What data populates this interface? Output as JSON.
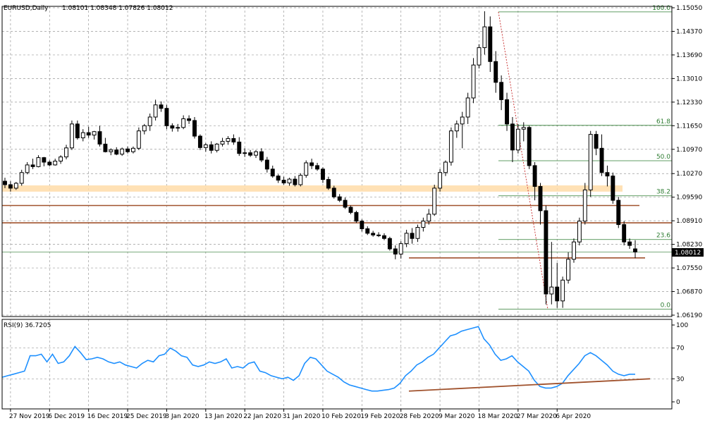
{
  "header": {
    "symbol": "EURUSD,Daily",
    "ohlc": "1.08101 1.08348 1.07826 1.08012"
  },
  "rsi": {
    "label": "RSI(9) 36.7205",
    "ticks": [
      "100",
      "70",
      "30",
      "0"
    ],
    "color": "#1e90ff"
  },
  "price_tag": {
    "value": "1.08012",
    "bg": "#000000"
  },
  "fib_color": "#2e7d32",
  "trendline_color": "#a0522d",
  "chart_data": {
    "type": "candlestick",
    "title": "EURUSD,Daily",
    "y_ticks": [
      "1.15050",
      "1.14370",
      "1.13690",
      "1.13010",
      "1.12330",
      "1.11650",
      "1.10970",
      "1.10270",
      "1.09590",
      "1.08910",
      "1.08230",
      "1.07550",
      "1.06870",
      "1.06190"
    ],
    "ylim": [
      1.0619,
      1.1505
    ],
    "x_ticks": [
      "27 Nov 2019",
      "6 Dec 2019",
      "16 Dec 2019",
      "25 Dec 2019",
      "3 Jan 2020",
      "13 Jan 2020",
      "22 Jan 2020",
      "31 Jan 2020",
      "10 Feb 2020",
      "19 Feb 2020",
      "28 Feb 2020",
      "9 Mar 2020",
      "18 Mar 2020",
      "27 Mar 2020",
      "6 Apr 2020"
    ],
    "candles": [
      [
        "1.1005",
        "1.1015",
        "1.0985",
        "1.0995"
      ],
      [
        "1.0995",
        "1.1005",
        "1.0975",
        "1.0985"
      ],
      [
        "1.0985",
        "1.1003",
        "1.0980",
        "1.0999"
      ],
      [
        "1.0999",
        "1.1038",
        "1.0992",
        "1.1030"
      ],
      [
        "1.1030",
        "1.1060",
        "1.1025",
        "1.1052"
      ],
      [
        "1.1052",
        "1.1070",
        "1.1040",
        "1.1047"
      ],
      [
        "1.1047",
        "1.1080",
        "1.1045",
        "1.1073"
      ],
      [
        "1.1073",
        "1.1075",
        "1.1048",
        "1.1060"
      ],
      [
        "1.1060",
        "1.1065",
        "1.1048",
        "1.1052"
      ],
      [
        "1.1052",
        "1.1070",
        "1.1050",
        "1.1063"
      ],
      [
        "1.1063",
        "1.1080",
        "1.1055",
        "1.1075"
      ],
      [
        "1.1075",
        "1.1110",
        "1.1068",
        "1.1101"
      ],
      [
        "1.1101",
        "1.1180",
        "1.1095",
        "1.1170"
      ],
      [
        "1.1170",
        "1.1180",
        "1.1125",
        "1.1130"
      ],
      [
        "1.1130",
        "1.1155",
        "1.1120",
        "1.1145"
      ],
      [
        "1.1145",
        "1.1162",
        "1.1130",
        "1.1138"
      ],
      [
        "1.1138",
        "1.1150",
        "1.1125",
        "1.1148"
      ],
      [
        "1.1148",
        "1.1165",
        "1.1105",
        "1.1112"
      ],
      [
        "1.1112",
        "1.1130",
        "1.1088",
        "1.1090"
      ],
      [
        "1.1090",
        "1.1100",
        "1.1080",
        "1.1095"
      ],
      [
        "1.1095",
        "1.1103",
        "1.1080",
        "1.1083"
      ],
      [
        "1.1083",
        "1.1102",
        "1.1078",
        "1.1098"
      ],
      [
        "1.1098",
        "1.1105",
        "1.1085",
        "1.1090"
      ],
      [
        "1.1090",
        "1.1105",
        "1.1085",
        "1.1100"
      ],
      [
        "1.1100",
        "1.1160",
        "1.1095",
        "1.1150"
      ],
      [
        "1.1150",
        "1.1170",
        "1.1140",
        "1.1165"
      ],
      [
        "1.1165",
        "1.1200",
        "1.1150",
        "1.1190"
      ],
      [
        "1.1190",
        "1.1240",
        "1.1180",
        "1.1225"
      ],
      [
        "1.1225",
        "1.1235",
        "1.1205",
        "1.1215"
      ],
      [
        "1.1215",
        "1.1225",
        "1.1155",
        "1.1165"
      ],
      [
        "1.1165",
        "1.1172",
        "1.1148",
        "1.1158"
      ],
      [
        "1.1158",
        "1.1170",
        "1.1148",
        "1.1160"
      ],
      [
        "1.1160",
        "1.1195",
        "1.1155",
        "1.1185"
      ],
      [
        "1.1185",
        "1.1195",
        "1.1170",
        "1.1180"
      ],
      [
        "1.1180",
        "1.1190",
        "1.1128",
        "1.1135"
      ],
      [
        "1.1135",
        "1.1140",
        "1.1095",
        "1.1102"
      ],
      [
        "1.1102",
        "1.1115",
        "1.1090",
        "1.1110"
      ],
      [
        "1.1110",
        "1.1120",
        "1.1085",
        "1.1094"
      ],
      [
        "1.1094",
        "1.1115",
        "1.1088",
        "1.1112"
      ],
      [
        "1.1112",
        "1.1130",
        "1.1105",
        "1.1120"
      ],
      [
        "1.1120",
        "1.1135",
        "1.1110",
        "1.1128"
      ],
      [
        "1.1128",
        "1.1140",
        "1.1110",
        "1.1118"
      ],
      [
        "1.1118",
        "1.1132",
        "1.1078",
        "1.1085"
      ],
      [
        "1.1085",
        "1.1100",
        "1.1075",
        "1.1087"
      ],
      [
        "1.1087",
        "1.1095",
        "1.1075",
        "1.1080"
      ],
      [
        "1.1080",
        "1.1095",
        "1.1072",
        "1.1090"
      ],
      [
        "1.1090",
        "1.1100",
        "1.1060",
        "1.1066"
      ],
      [
        "1.1066",
        "1.1075",
        "1.1030",
        "1.1040"
      ],
      [
        "1.1040",
        "1.1050",
        "1.1015",
        "1.1020"
      ],
      [
        "1.1020",
        "1.1025",
        "1.1000",
        "1.1008"
      ],
      [
        "1.1008",
        "1.1018",
        "1.0995",
        "1.1000"
      ],
      [
        "1.1000",
        "1.1015",
        "1.0992",
        "1.1011"
      ],
      [
        "1.1011",
        "1.1020",
        "1.0990",
        "1.0995"
      ],
      [
        "1.0995",
        "1.1028",
        "1.0990",
        "1.1022"
      ],
      [
        "1.1022",
        "1.1065",
        "1.1015",
        "1.1058"
      ],
      [
        "1.1058",
        "1.1070",
        "1.1040",
        "1.1050"
      ],
      [
        "1.1050",
        "1.1058",
        "1.1035",
        "1.1040"
      ],
      [
        "1.1040",
        "1.1045",
        "1.1000",
        "1.1010"
      ],
      [
        "1.1010",
        "1.1018",
        "1.0980",
        "1.0985"
      ],
      [
        "1.0985",
        "1.0992",
        "1.0955",
        "1.0960"
      ],
      [
        "1.0960",
        "1.0968",
        "1.0945",
        "1.0950"
      ],
      [
        "1.0950",
        "1.0958",
        "1.0925",
        "1.0930"
      ],
      [
        "1.0930",
        "1.0935",
        "1.0910",
        "1.0915"
      ],
      [
        "1.0915",
        "1.0920",
        "1.0885",
        "1.0890"
      ],
      [
        "1.0890",
        "1.0895",
        "1.0860",
        "1.0868"
      ],
      [
        "1.0868",
        "1.0875",
        "1.0850",
        "1.0855"
      ],
      [
        "1.0855",
        "1.0862",
        "1.0845",
        "1.0850"
      ],
      [
        "1.0850",
        "1.0858",
        "1.0844",
        "1.0848"
      ],
      [
        "1.0848",
        "1.0855",
        "1.0835",
        "1.0840"
      ],
      [
        "1.0840",
        "1.0845",
        "1.0805",
        "1.0810"
      ],
      [
        "1.0810",
        "1.0820",
        "1.0780",
        "1.0795"
      ],
      [
        "1.0795",
        "1.0832",
        "1.0782",
        "1.0825"
      ],
      [
        "1.0825",
        "1.0865",
        "1.0815",
        "1.0855"
      ],
      [
        "1.0855",
        "1.0870",
        "1.0825",
        "1.0840"
      ],
      [
        "1.0840",
        "1.0880",
        "1.0830",
        "1.0872"
      ],
      [
        "1.0872",
        "1.0900",
        "1.0860",
        "1.0890"
      ],
      [
        "1.0890",
        "1.0925",
        "1.0880",
        "1.0910"
      ],
      [
        "1.0910",
        "1.0995",
        "1.0905",
        "1.0985"
      ],
      [
        "1.0985",
        "1.1040",
        "1.0975",
        "1.1030"
      ],
      [
        "1.1030",
        "1.1065",
        "1.1020",
        "1.1060"
      ],
      [
        "1.1060",
        "1.1160",
        "1.1050",
        "1.1150"
      ],
      [
        "1.1150",
        "1.1180",
        "1.1130",
        "1.1170"
      ],
      [
        "1.1170",
        "1.1205",
        "1.1100",
        "1.1190"
      ],
      [
        "1.1190",
        "1.1260",
        "1.1170",
        "1.1245"
      ],
      [
        "1.1245",
        "1.1360",
        "1.1230",
        "1.1340"
      ],
      [
        "1.1340",
        "1.1400",
        "1.1330",
        "1.1390"
      ],
      [
        "1.1390",
        "1.1495",
        "1.1370",
        "1.1450"
      ],
      [
        "1.1450",
        "1.1480",
        "1.1320",
        "1.1350"
      ],
      [
        "1.1350",
        "1.1380",
        "1.1260",
        "1.1290"
      ],
      [
        "1.1290",
        "1.1310",
        "1.1210",
        "1.1240"
      ],
      [
        "1.1240",
        "1.1260",
        "1.1150",
        "1.1170"
      ],
      [
        "1.1170",
        "1.1190",
        "1.1060",
        "1.1095"
      ],
      [
        "1.1095",
        "1.1170",
        "1.1085",
        "1.1155"
      ],
      [
        "1.1155",
        "1.1175",
        "1.1120",
        "1.1160"
      ],
      [
        "1.1160",
        "1.1165",
        "1.1040",
        "1.1050"
      ],
      [
        "1.1050",
        "1.1060",
        "1.0950",
        "1.0990"
      ],
      [
        "1.0990",
        "1.1000",
        "1.0880",
        "1.0920"
      ],
      [
        "1.0920",
        "1.0935",
        "1.0650",
        "1.0680"
      ],
      [
        "1.0680",
        "1.0830",
        "1.0650",
        "1.0700"
      ],
      [
        "1.0700",
        "1.0770",
        "1.0640",
        "1.0660"
      ],
      [
        "1.0660",
        "1.0730",
        "1.0640",
        "1.0720"
      ],
      [
        "1.0720",
        "1.0800",
        "1.0710",
        "1.0780"
      ],
      [
        "1.0780",
        "1.0840",
        "1.0770",
        "1.0830"
      ],
      [
        "1.0830",
        "1.0900",
        "1.0820",
        "1.0890"
      ],
      [
        "1.0890",
        "1.1000",
        "1.0880",
        "1.0980"
      ],
      [
        "1.0980",
        "1.1150",
        "1.0960",
        "1.1140"
      ],
      [
        "1.1140",
        "1.1150",
        "1.1080",
        "1.1100"
      ],
      [
        "1.1100",
        "1.1140",
        "1.1020",
        "1.1030"
      ],
      [
        "1.1030",
        "1.1050",
        "1.0990",
        "1.1020"
      ],
      [
        "1.1020",
        "1.1030",
        "1.0940",
        "1.0950"
      ],
      [
        "1.0950",
        "1.0960",
        "1.0870",
        "1.0880"
      ],
      [
        "1.0880",
        "1.0890",
        "1.0820",
        "1.0830"
      ],
      [
        "1.0830",
        "1.0840",
        "1.0810",
        "1.0820"
      ],
      [
        "1.0810",
        "1.0835",
        "1.0783",
        "1.0801"
      ]
    ],
    "rsi_values": [
      32,
      34,
      36,
      38,
      40,
      60,
      60,
      62,
      52,
      62,
      50,
      52,
      60,
      72,
      64,
      55,
      56,
      58,
      56,
      52,
      50,
      52,
      48,
      46,
      44,
      50,
      54,
      52,
      60,
      62,
      70,
      66,
      60,
      58,
      48,
      46,
      48,
      52,
      50,
      52,
      56,
      44,
      46,
      44,
      50,
      52,
      40,
      38,
      34,
      32,
      30,
      32,
      28,
      34,
      50,
      58,
      56,
      48,
      40,
      36,
      32,
      26,
      22,
      20,
      18,
      16,
      14,
      14,
      15,
      16,
      18,
      24,
      34,
      40,
      48,
      52,
      58,
      62,
      70,
      78,
      86,
      88,
      92,
      94,
      96,
      98,
      82,
      74,
      62,
      54,
      56,
      60,
      52,
      46,
      40,
      28,
      20,
      18,
      18,
      20,
      24,
      34,
      42,
      50,
      60,
      64,
      60,
      54,
      48,
      40,
      36,
      34,
      36,
      36
    ],
    "levels": [
      {
        "label": "100.0",
        "price": 1.1493
      },
      {
        "label": "61.8",
        "price": 1.1166
      },
      {
        "label": "50.0",
        "price": 1.1064
      },
      {
        "label": "38.2",
        "price": 1.0963
      },
      {
        "label": "23.6",
        "price": 1.0837
      },
      {
        "label": "0.0",
        "price": 1.0636
      }
    ]
  }
}
